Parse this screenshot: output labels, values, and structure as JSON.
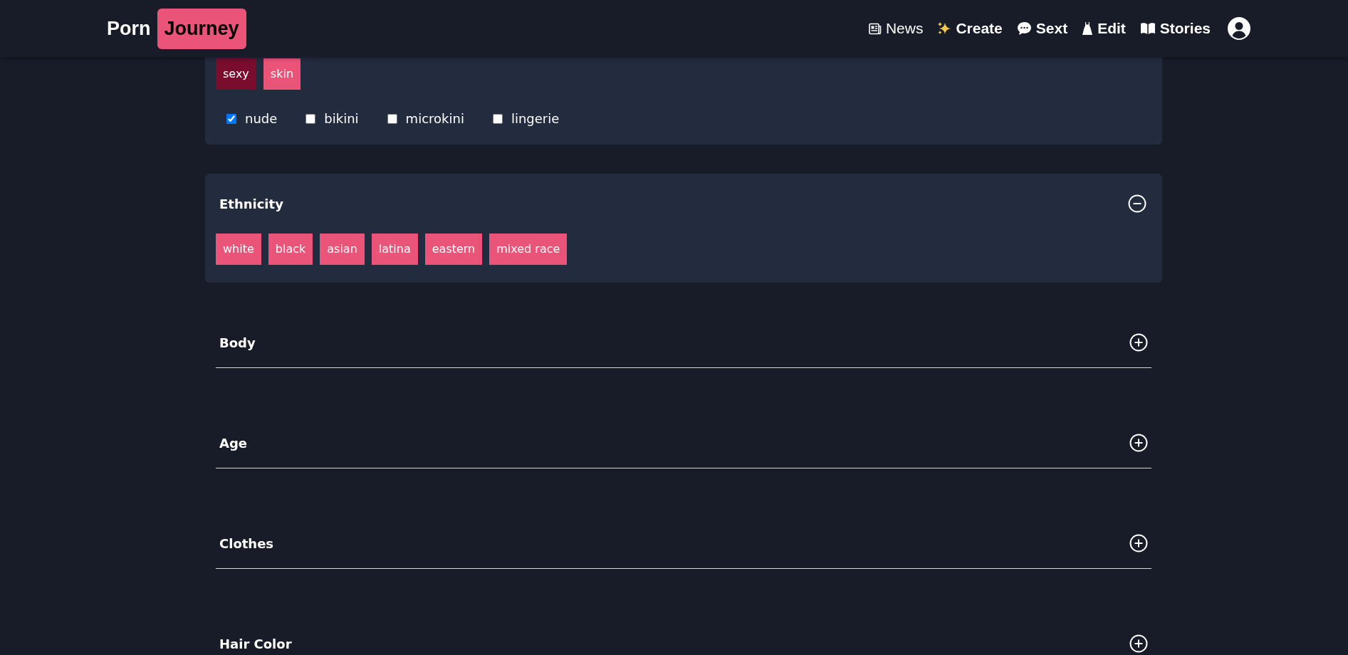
{
  "header": {
    "logo": {
      "part_1": "Porn",
      "part_2": "Journey"
    },
    "nav": [
      {
        "label": "News",
        "kind": "news"
      },
      {
        "label": "Create",
        "kind": "create"
      },
      {
        "label": "Sext",
        "kind": "sext"
      },
      {
        "label": "Edit",
        "kind": "edit"
      },
      {
        "label": "Stories",
        "kind": "stories"
      }
    ]
  },
  "sections": [
    {
      "tags": [
        {
          "label": "sexy",
          "selected": true
        },
        {
          "label": "skin",
          "selected": false
        }
      ],
      "options": [
        {
          "label": "nude",
          "checked": true
        },
        {
          "label": "bikini",
          "checked": false
        },
        {
          "label": "microkini",
          "checked": false
        },
        {
          "label": "lingerie",
          "checked": false
        }
      ]
    },
    {
      "title": "Ethnicity",
      "expanded": true,
      "tags": [
        {
          "label": "white",
          "selected": false
        },
        {
          "label": "black",
          "selected": false
        },
        {
          "label": "asian",
          "selected": false
        },
        {
          "label": "latina",
          "selected": false
        },
        {
          "label": "eastern",
          "selected": false
        },
        {
          "label": "mixed race",
          "selected": false
        }
      ]
    },
    {
      "title": "Body",
      "expanded": false
    },
    {
      "title": "Age",
      "expanded": false
    },
    {
      "title": "Clothes",
      "expanded": false
    },
    {
      "title": "Hair Color",
      "expanded": false
    }
  ]
}
